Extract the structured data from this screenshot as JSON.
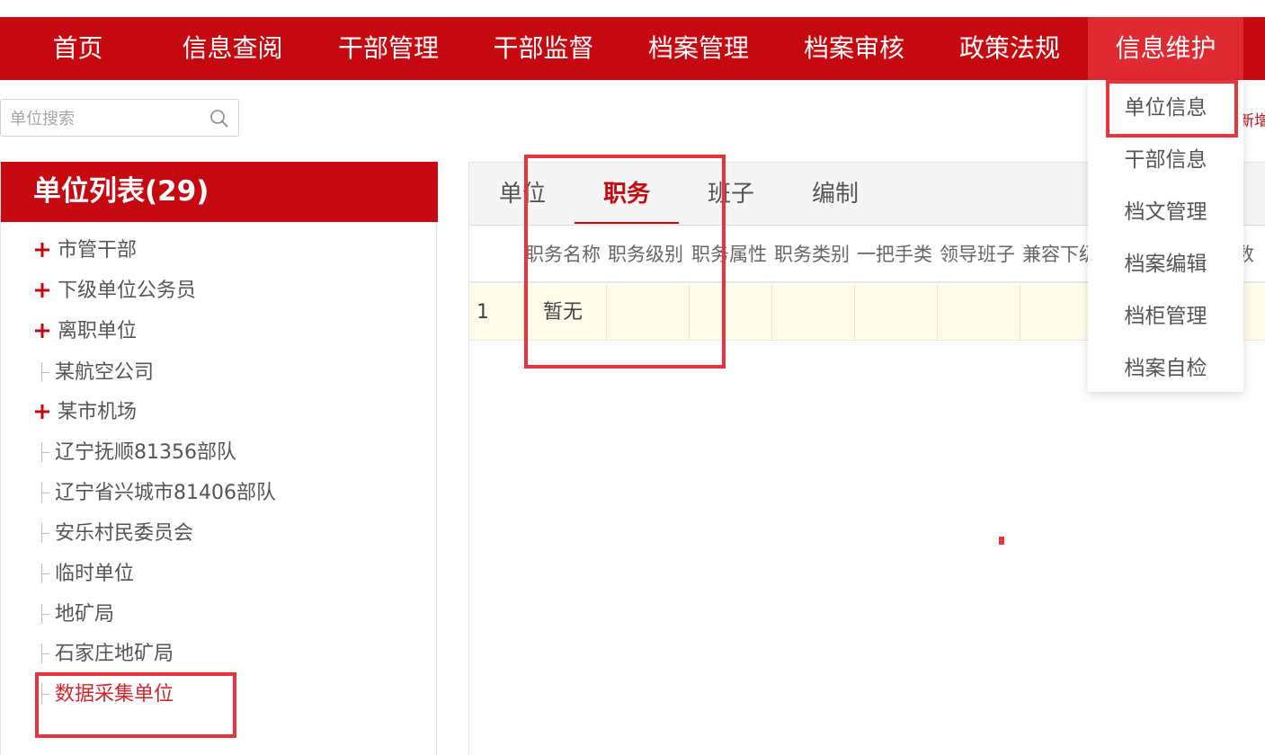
{
  "nav": {
    "items": [
      "首页",
      "信息查阅",
      "干部管理",
      "干部监督",
      "档案管理",
      "档案审核",
      "政策法规",
      "信息维护"
    ],
    "active_index": 7
  },
  "search": {
    "placeholder": "单位搜索"
  },
  "left": {
    "title": "单位列表(29)",
    "items": [
      {
        "label": "市管干部",
        "expandable": true
      },
      {
        "label": "下级单位公务员",
        "expandable": true
      },
      {
        "label": "离职单位",
        "expandable": true
      },
      {
        "label": "某航空公司",
        "expandable": false
      },
      {
        "label": "某市机场",
        "expandable": true
      },
      {
        "label": "辽宁抚顺81356部队",
        "expandable": false
      },
      {
        "label": "辽宁省兴城市81406部队",
        "expandable": false
      },
      {
        "label": "安乐村民委员会",
        "expandable": false
      },
      {
        "label": "临时单位",
        "expandable": false
      },
      {
        "label": "地矿局",
        "expandable": false
      },
      {
        "label": "石家庄地矿局",
        "expandable": false
      },
      {
        "label": "数据采集单位",
        "expandable": false,
        "selected": true
      }
    ]
  },
  "tabs": [
    "单位",
    "职务",
    "班子",
    "编制"
  ],
  "active_tab": 1,
  "table": {
    "headers": [
      "职务名称",
      "职务级别",
      "职务属性",
      "职务类别",
      "一把手类",
      "领导班子",
      "兼容下级",
      "",
      "数"
    ],
    "rows": [
      [
        "1",
        "暂无"
      ]
    ]
  },
  "new_link": "新增",
  "dropdown": {
    "items": [
      "单位信息",
      "干部信息",
      "档文管理",
      "档案编辑",
      "档柜管理",
      "档案自检"
    ]
  },
  "colors": {
    "brand": "#c60910",
    "accent": "#df2a31",
    "annotation": "#e8343b",
    "row_highlight": "#fffcea"
  }
}
